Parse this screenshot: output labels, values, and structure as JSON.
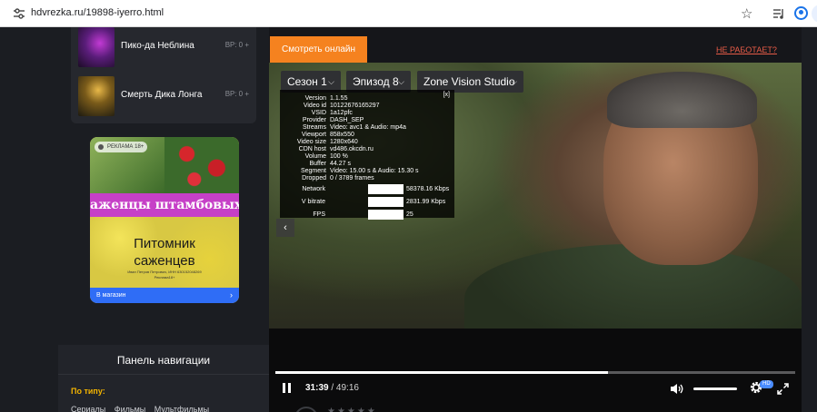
{
  "browser": {
    "url": "hdvrezka.ru/19898-iyerro.html"
  },
  "sidebar": {
    "related": [
      {
        "title": "Пико-да Неблина",
        "score": "ВР: 0 +"
      },
      {
        "title": "Смерть Дика Лонга",
        "score": "ВР: 0 +"
      }
    ],
    "ad": {
      "label": "РЕКЛАМА 18+",
      "banner": "аженцы штамбовых Ро",
      "headline_1": "Питомник",
      "headline_2": "саженцев",
      "fine_1": "Иван Петров Петрович, ИНН 630152048269",
      "fine_2": "Реклама18+",
      "cta": "В магазин"
    },
    "nav_panel": {
      "title": "Панель навигации",
      "by_type": "По типу:",
      "links": [
        "Сериалы",
        "Фильмы",
        "Мультфильмы"
      ]
    }
  },
  "main": {
    "watch_button": "Смотреть онлайн",
    "broken_link": "НЕ РАБОТАЕТ?",
    "selectors": {
      "season": "Сезон 1",
      "episode": "Эпизод 8",
      "studio": "Zone Vision Studio"
    },
    "stats": {
      "close": "[x]",
      "rows": [
        {
          "k": "Version",
          "v": "1.1.55"
        },
        {
          "k": "Video id",
          "v": "10122676165297"
        },
        {
          "k": "VSID",
          "v": "1a12pfc"
        },
        {
          "k": "Provider",
          "v": "DASH_SEP"
        },
        {
          "k": "Streams",
          "v": "Video: avc1 & Audio: mp4a"
        },
        {
          "k": "Viewport",
          "v": "858x550"
        },
        {
          "k": "Video size",
          "v": "1280x640"
        },
        {
          "k": "CDN host",
          "v": "vd486.okcdn.ru"
        },
        {
          "k": "Volume",
          "v": "100 %"
        },
        {
          "k": "Buffer",
          "v": "44.27 s"
        },
        {
          "k": "Segment",
          "v": "Video: 15.00 s & Audio: 15.30 s"
        },
        {
          "k": "Dropped",
          "v": "0 / 3789 frames"
        }
      ],
      "graphs": [
        {
          "k": "Network",
          "v": "58378.16 Kbps"
        },
        {
          "k": "V bitrate",
          "v": "2831.99 Kbps"
        },
        {
          "k": "FPS",
          "v": "25"
        }
      ]
    },
    "controls": {
      "current_time": "31:39",
      "separator": " / ",
      "total_time": "49:16",
      "progress_fraction": 0.64,
      "volume_fraction": 1.0,
      "quality_badge": "HD"
    },
    "icons": [
      "pause-icon",
      "volume-icon",
      "settings-gear-icon",
      "fullscreen-icon",
      "chevron-left-icon"
    ]
  },
  "colors": {
    "accent": "#f5821f",
    "warning_link": "#e85c47",
    "nav_heading": "#f4b400",
    "cta": "#2f6df6"
  }
}
